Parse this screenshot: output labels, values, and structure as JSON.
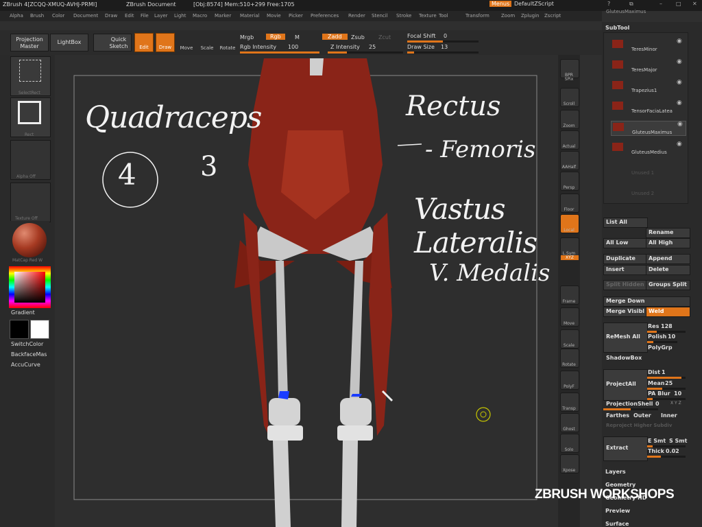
{
  "titlebar": {
    "app": "ZBrush 4[ZCQQ-XMUQ-AVHJ-PRMI]",
    "document": "ZBrush Document",
    "stats": "[Obj:8574] Mem:510+299 Free:1705",
    "menus_btn": "Menus",
    "zscript_btn": "DefaultZScript"
  },
  "menubar": [
    "Alpha",
    "Brush",
    "Color",
    "Document",
    "Draw",
    "Edit",
    "File",
    "Layer",
    "Light",
    "Macro",
    "Marker",
    "Material",
    "Movie",
    "Picker",
    "Preferences",
    "Render",
    "Stencil",
    "Stroke",
    "Texture",
    "Tool",
    "Transform",
    "Zoom",
    "Zplugin",
    "Zscript"
  ],
  "toolbar": {
    "projection_master": "Projection Master",
    "lightbox": "LightBox",
    "quick_sketch": "Quick Sketch",
    "edit": "Edit",
    "draw": "Draw",
    "move": "Move",
    "scale": "Scale",
    "rotate": "Rotate",
    "mrgb": "Mrgb",
    "rgb": "Rgb",
    "m": "M",
    "rgb_intensity_label": "Rgb Intensity",
    "rgb_intensity_value": "100",
    "zadd": "Zadd",
    "zsub": "Zsub",
    "zcut": "Zcut",
    "z_intensity_label": "Z Intensity",
    "z_intensity_value": "25",
    "focal_shift_label": "Focal Shift",
    "focal_shift_value": "0",
    "draw_size_label": "Draw Size",
    "draw_size_value": "13"
  },
  "lefttray": {
    "select_rect": "SelectRect",
    "rect": "Rect",
    "alpha_off": "Alpha  Off",
    "texture_off": "Texture  Off",
    "matcap": "MatCap Red W",
    "gradient": "Gradient",
    "switch_color": "SwitchColor",
    "backface_mask": "BackfaceMas",
    "accucurve": "AccuCurve"
  },
  "rightbar": [
    "BPR",
    "SPix",
    "Scroll",
    "Zoom",
    "Actual",
    "AAHalf",
    "Persp",
    "Floor",
    "Local",
    "L.Sym",
    "XYZ",
    "Frame",
    "Move",
    "Scale",
    "Rotate",
    "PolyF",
    "Transp",
    "Ghost",
    "Solo",
    "Xpose"
  ],
  "rpanel": {
    "top_item": "GluteusMaximus",
    "subtool_title": "SubTool",
    "subtools": [
      "TeresMinor",
      "TeresMajor",
      "Trapezius1",
      "TensorFaciaLatea",
      "GluteusMaximus",
      "GluteusMedius",
      "Unused 1",
      "Unused 2"
    ],
    "list_all": "List All",
    "rename": "Rename",
    "all_low": "All Low",
    "all_high": "All High",
    "duplicate": "Duplicate",
    "append": "Append",
    "insert": "Insert",
    "delete": "Delete",
    "split_hidden": "Split Hidden",
    "groups_split": "Groups Split",
    "merge_down": "Merge Down",
    "merge_visible": "Merge Visibl",
    "weld": "Weld",
    "remesh_all": "ReMesh All",
    "res_label": "Res",
    "res_value": "128",
    "polish_label": "Polish",
    "polish_value": "10",
    "polygrp": "PolyGrp",
    "shadowbox": "ShadowBox",
    "project_all": "ProjectAll",
    "dist_label": "Dist",
    "dist_value": "1",
    "mean_label": "Mean",
    "mean_value": "25",
    "pa_blur_label": "PA Blur",
    "pa_blur_value": "10",
    "projection_shell_label": "ProjectionShell",
    "projection_shell_value": "0",
    "xyz_small": "X Y Z",
    "farthest": "Farthes",
    "outer": "Outer",
    "inner": "Inner",
    "reproject": "Reproject Higher Subdiv",
    "extract": "Extract",
    "e_smt": "E Smt",
    "s_smt": "S Smt",
    "thick_label": "Thick",
    "thick_value": "0.02",
    "layers": "Layers",
    "geometry": "Geometry",
    "geometry_hd": "Geometry HD",
    "preview": "Preview",
    "surface": "Surface"
  },
  "annotations": {
    "quadriceps": "Quadraceps",
    "four": "4",
    "three": "3",
    "rectus": "Rectus",
    "femoris": "- Femoris",
    "vastus": "Vastus Lateralis",
    "medialis": "V. Medalis"
  },
  "watermark": "ZBRUSH WORKSHOPS",
  "colors": {
    "accent": "#e0751a",
    "muscle": "#8a2418",
    "bone": "#d0d0d0",
    "background": "#2f2f2f"
  }
}
